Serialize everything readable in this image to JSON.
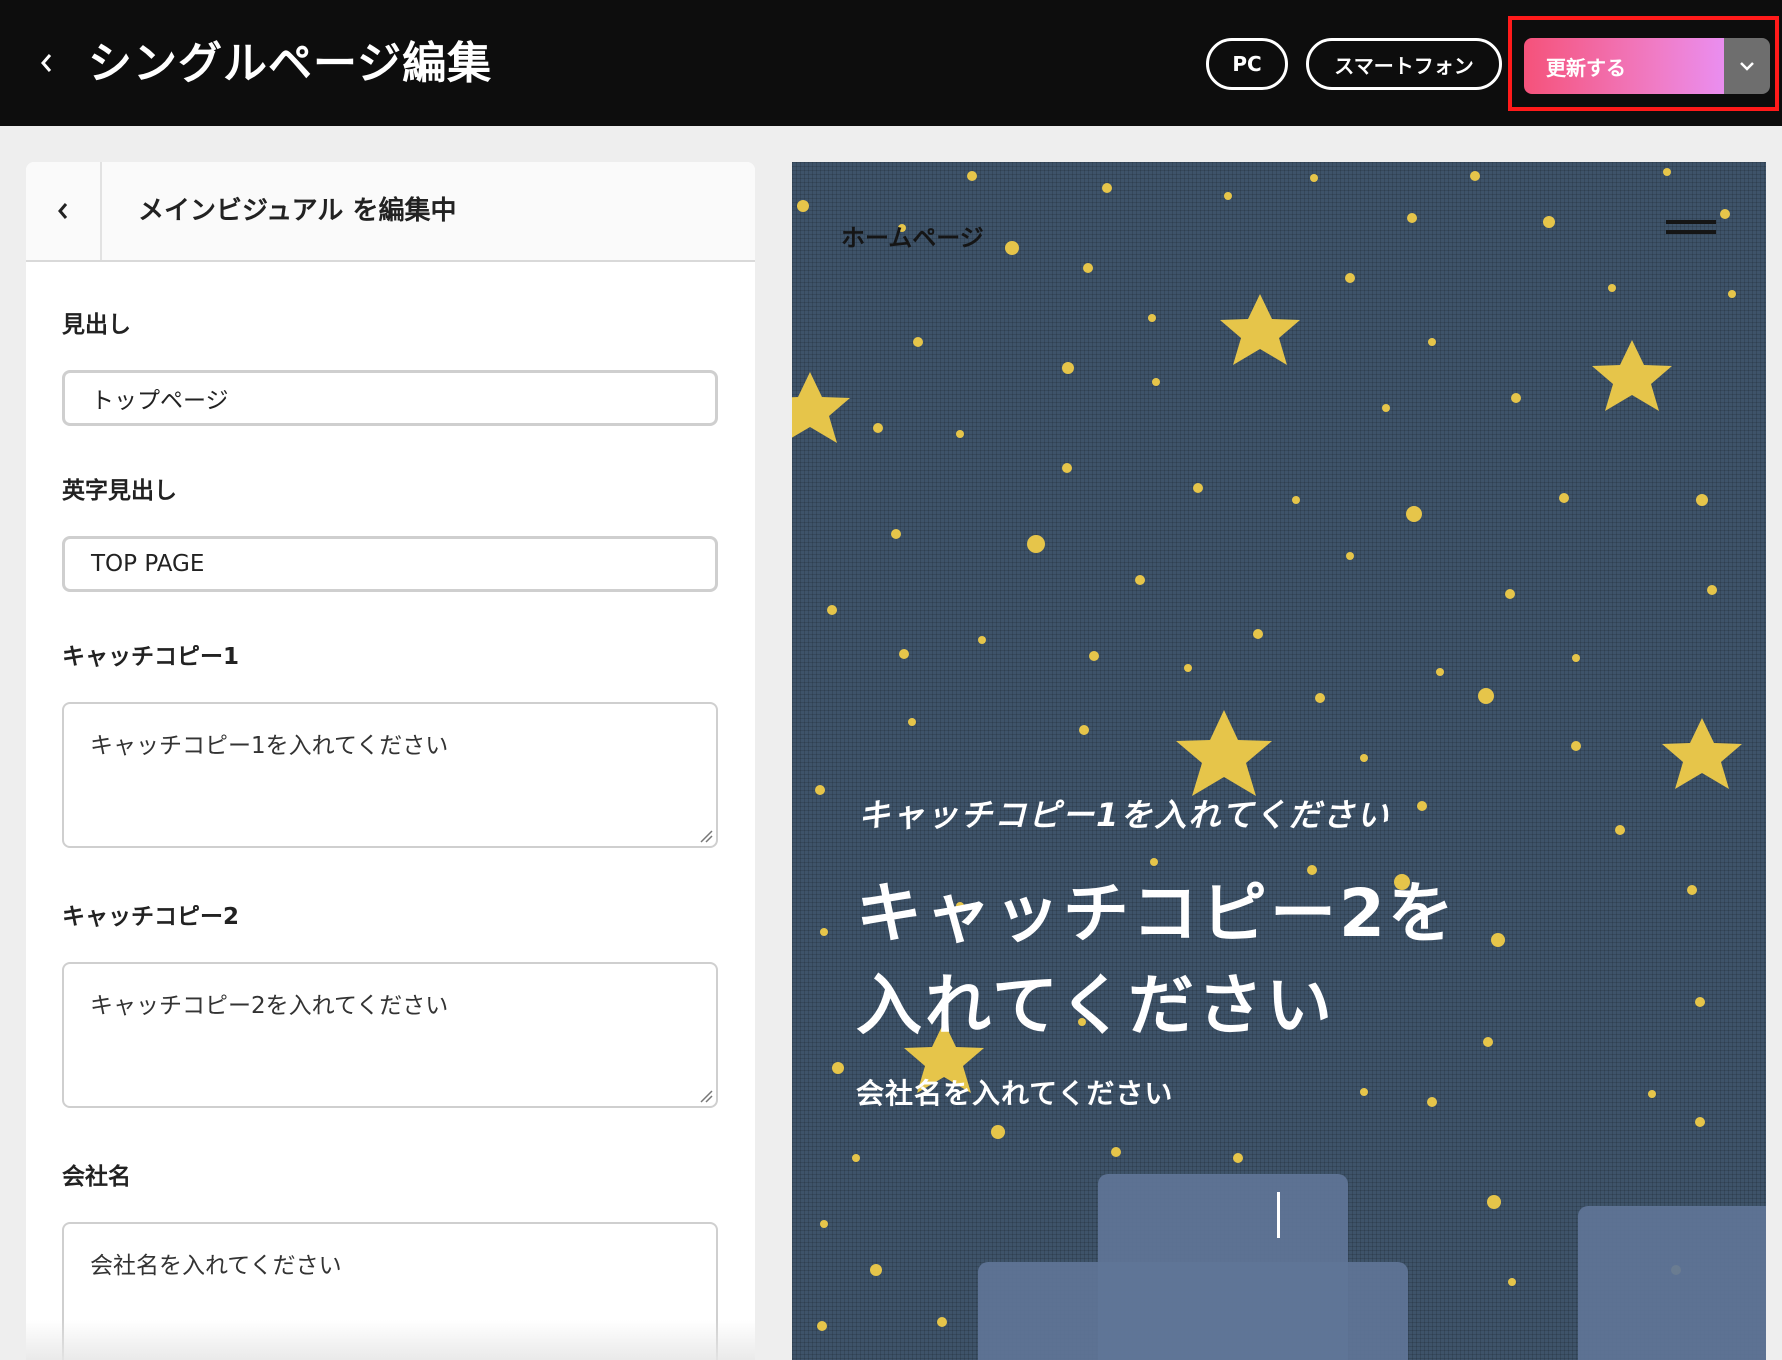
{
  "header": {
    "title": "シングルページ編集",
    "pc_label": "PC",
    "smartphone_label": "スマートフォン",
    "update_label": "更新する"
  },
  "editor": {
    "title": "メインビジュアル を編集中",
    "fields": {
      "heading": {
        "label": "見出し",
        "value": "トップページ"
      },
      "en_heading": {
        "label": "英字見出し",
        "value": "TOP PAGE"
      },
      "catch1": {
        "label": "キャッチコピー1",
        "value": "キャッチコピー1を入れてください"
      },
      "catch2": {
        "label": "キャッチコピー2",
        "value": "キャッチコピー2を入れてください"
      },
      "company": {
        "label": "会社名",
        "value": "会社名を入れてください"
      }
    }
  },
  "preview": {
    "site_name": "ホームページ",
    "catch1": "キャッチコピー1を入れてください",
    "catch2": "キャッチコピー2を入れてください",
    "company": "会社名を入れてください"
  },
  "colors": {
    "highlight_border": "#ff1a1a",
    "update_gradient_start": "#f5527a",
    "update_gradient_end": "#ea8ef0",
    "preview_bg": "#3e5369",
    "star": "#e6c54a"
  },
  "icons": {
    "back": "chevron-left-icon",
    "dropdown": "chevron-down-icon",
    "menu": "hamburger-menu-icon"
  }
}
